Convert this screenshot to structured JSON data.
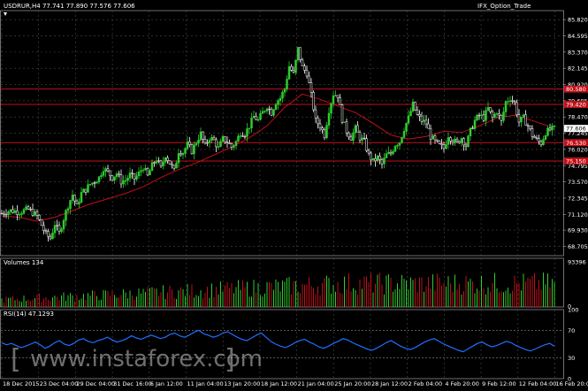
{
  "header": {
    "symbol_text": "USDRUR,H4  77.741 77.890 77.576 77.606",
    "indicator_name": "IFX_Option_Trade"
  },
  "colors": {
    "background": "#000000",
    "grid": "#4a4a4a",
    "bull": "#2ecc2e",
    "bear": "#ffffff",
    "level": "#c0101a",
    "ma": "#c0101a",
    "volume_up": "#2ecc2e",
    "volume_down": "#c0101a",
    "rsi": "#1e6fff",
    "price_tag": "#c0101a"
  },
  "chart_data": [
    {
      "type": "candlestick",
      "title": "USDRUR,H4",
      "ylim": [
        68.0,
        86.5
      ],
      "y_ticks": [
        "85.820",
        "84.595",
        "83.370",
        "82.145",
        "80.920",
        "79.695",
        "78.470",
        "77.245",
        "76.020",
        "74.795",
        "73.570",
        "72.345",
        "71.120",
        "69.930",
        "68.705"
      ],
      "x_ticks": [
        "18 Dec 2015",
        "23 Dec 04:00",
        "29 Dec 04:00",
        "31 Dec 16:00",
        "6 Jan 12:00",
        "11 Jan 04:00",
        "13 Jan 20:00",
        "18 Jan 12:00",
        "21 Jan 04:00",
        "25 Jan 20:00",
        "28 Jan 12:00",
        "2 Feb 04:00",
        "4 Feb 20:00",
        "9 Feb 12:00",
        "12 Feb 04:00",
        "16 Feb 20:00"
      ],
      "levels": [
        {
          "value": 80.58,
          "label": "80.580"
        },
        {
          "value": 79.42,
          "label": "79.420"
        },
        {
          "value": 76.53,
          "label": "76.530"
        },
        {
          "value": 75.15,
          "label": "75.150"
        }
      ],
      "last_price": {
        "value": 77.606,
        "label": "77.606"
      },
      "moving_average_path": [
        [
          0,
          71.0
        ],
        [
          20,
          70.9
        ],
        [
          40,
          70.6
        ],
        [
          60,
          70.9
        ],
        [
          80,
          71.4
        ],
        [
          100,
          71.9
        ],
        [
          120,
          72.3
        ],
        [
          140,
          72.7
        ],
        [
          160,
          73.2
        ],
        [
          180,
          73.9
        ],
        [
          200,
          74.5
        ],
        [
          220,
          75.0
        ],
        [
          240,
          75.6
        ],
        [
          260,
          76.2
        ],
        [
          280,
          76.9
        ],
        [
          300,
          77.8
        ],
        [
          320,
          79.2
        ],
        [
          340,
          80.2
        ],
        [
          360,
          79.8
        ],
        [
          380,
          79.3
        ],
        [
          400,
          78.8
        ],
        [
          420,
          78.0
        ],
        [
          440,
          77.1
        ],
        [
          460,
          76.8
        ],
        [
          480,
          77.0
        ],
        [
          500,
          77.4
        ],
        [
          520,
          77.3
        ],
        [
          540,
          77.8
        ],
        [
          560,
          78.4
        ],
        [
          580,
          78.6
        ],
        [
          600,
          78.2
        ],
        [
          618,
          77.8
        ]
      ],
      "price_path": [
        [
          0,
          71.2
        ],
        [
          10,
          71.4
        ],
        [
          20,
          71.3
        ],
        [
          30,
          71.5
        ],
        [
          40,
          71.0
        ],
        [
          50,
          69.6
        ],
        [
          55,
          69.3
        ],
        [
          60,
          70.4
        ],
        [
          65,
          69.7
        ],
        [
          70,
          70.8
        ],
        [
          75,
          71.8
        ],
        [
          80,
          72.6
        ],
        [
          85,
          71.7
        ],
        [
          90,
          72.7
        ],
        [
          95,
          73.0
        ],
        [
          100,
          73.4
        ],
        [
          105,
          73.6
        ],
        [
          110,
          73.9
        ],
        [
          115,
          74.6
        ],
        [
          120,
          74.3
        ],
        [
          125,
          73.9
        ],
        [
          130,
          74.2
        ],
        [
          135,
          73.6
        ],
        [
          140,
          73.7
        ],
        [
          145,
          74.1
        ],
        [
          150,
          73.8
        ],
        [
          155,
          74.2
        ],
        [
          160,
          74.7
        ],
        [
          165,
          74.0
        ],
        [
          170,
          74.8
        ],
        [
          175,
          75.3
        ],
        [
          180,
          74.6
        ],
        [
          185,
          75.6
        ],
        [
          190,
          75.0
        ],
        [
          195,
          74.4
        ],
        [
          200,
          75.9
        ],
        [
          205,
          75.8
        ],
        [
          210,
          76.4
        ],
        [
          215,
          75.9
        ],
        [
          220,
          76.6
        ],
        [
          225,
          77.2
        ],
        [
          230,
          76.3
        ],
        [
          235,
          76.9
        ],
        [
          240,
          76.7
        ],
        [
          245,
          76.1
        ],
        [
          250,
          76.8
        ],
        [
          255,
          76.6
        ],
        [
          260,
          76.2
        ],
        [
          265,
          76.6
        ],
        [
          270,
          77.3
        ],
        [
          275,
          77.2
        ],
        [
          280,
          77.8
        ],
        [
          285,
          78.5
        ],
        [
          290,
          78.2
        ],
        [
          295,
          78.8
        ],
        [
          300,
          79.3
        ],
        [
          305,
          78.8
        ],
        [
          310,
          79.6
        ],
        [
          315,
          79.9
        ],
        [
          320,
          80.6
        ],
        [
          325,
          82.3
        ],
        [
          330,
          81.7
        ],
        [
          335,
          83.6
        ],
        [
          340,
          82.2
        ],
        [
          345,
          81.8
        ],
        [
          350,
          80.1
        ],
        [
          355,
          78.2
        ],
        [
          360,
          77.8
        ],
        [
          365,
          77.1
        ],
        [
          370,
          79.0
        ],
        [
          375,
          80.2
        ],
        [
          380,
          80.1
        ],
        [
          385,
          78.3
        ],
        [
          390,
          77.4
        ],
        [
          395,
          76.9
        ],
        [
          400,
          77.6
        ],
        [
          405,
          76.9
        ],
        [
          410,
          76.6
        ],
        [
          415,
          75.6
        ],
        [
          420,
          75.1
        ],
        [
          425,
          75.4
        ],
        [
          430,
          74.9
        ],
        [
          435,
          75.6
        ],
        [
          440,
          75.7
        ],
        [
          445,
          76.4
        ],
        [
          450,
          76.6
        ],
        [
          455,
          77.6
        ],
        [
          460,
          78.4
        ],
        [
          465,
          79.4
        ],
        [
          470,
          78.6
        ],
        [
          475,
          78.2
        ],
        [
          480,
          78.0
        ],
        [
          485,
          77.0
        ],
        [
          490,
          76.6
        ],
        [
          495,
          76.3
        ],
        [
          500,
          76.1
        ],
        [
          505,
          77.1
        ],
        [
          510,
          76.7
        ],
        [
          515,
          76.5
        ],
        [
          520,
          76.9
        ],
        [
          525,
          76.3
        ],
        [
          530,
          77.4
        ],
        [
          535,
          78.2
        ],
        [
          540,
          78.6
        ],
        [
          545,
          78.4
        ],
        [
          550,
          79.1
        ],
        [
          555,
          78.4
        ],
        [
          560,
          78.9
        ],
        [
          565,
          78.1
        ],
        [
          570,
          79.6
        ],
        [
          575,
          79.9
        ],
        [
          580,
          79.5
        ],
        [
          585,
          78.1
        ],
        [
          590,
          78.4
        ],
        [
          595,
          77.8
        ],
        [
          600,
          77.1
        ],
        [
          605,
          76.7
        ],
        [
          610,
          76.5
        ],
        [
          615,
          77.3
        ],
        [
          620,
          77.5
        ],
        [
          625,
          77.6
        ]
      ]
    },
    {
      "type": "bar",
      "title": "Volumes 134",
      "y_ticks": [
        "93396",
        "0"
      ],
      "note": "hourly volume histogram"
    },
    {
      "type": "line",
      "title": "RSI(14) 47.1293",
      "y_ticks": [
        "100",
        "70",
        "30",
        "0"
      ],
      "ylim": [
        0,
        100
      ],
      "values": [
        52,
        49,
        51,
        48,
        45,
        47,
        50,
        53,
        49,
        44,
        47,
        52,
        55,
        50,
        48,
        51,
        56,
        58,
        54,
        52,
        55,
        57,
        60,
        56,
        53,
        55,
        58,
        62,
        59,
        57,
        60,
        63,
        61,
        58,
        60,
        64,
        66,
        62,
        60,
        63,
        67,
        70,
        65,
        63,
        60,
        62,
        66,
        68,
        64,
        60,
        57,
        55,
        59,
        63,
        66,
        60,
        54,
        50,
        47,
        45,
        48,
        52,
        55,
        57,
        53,
        50,
        46,
        44,
        47,
        51,
        54,
        58,
        56,
        52,
        49,
        46,
        43,
        41,
        44,
        48,
        52,
        55,
        51,
        47,
        44,
        42,
        45,
        49,
        53,
        56,
        58,
        54,
        50,
        47,
        44,
        41,
        39,
        43,
        47,
        51,
        53,
        49,
        46,
        48,
        51,
        54,
        52,
        48,
        45,
        42,
        40,
        43,
        46,
        49,
        51,
        47
      ]
    }
  ],
  "watermark_text": "www.instaforex.com"
}
